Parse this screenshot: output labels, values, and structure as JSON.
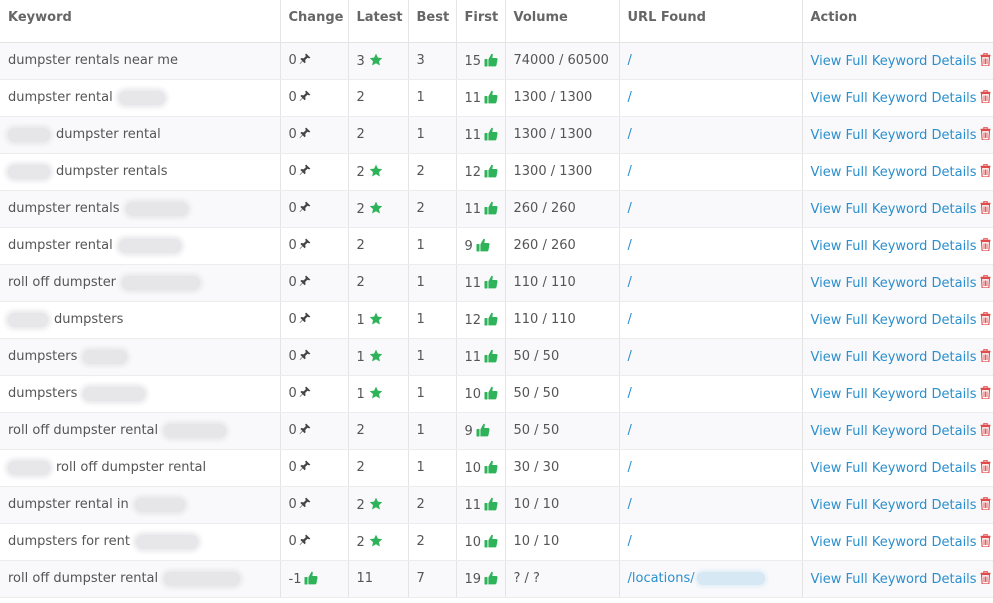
{
  "headers": {
    "keyword": "Keyword",
    "change": "Change",
    "latest": "Latest",
    "best": "Best",
    "first": "First",
    "volume": "Volume",
    "url": "URL Found",
    "action": "Action"
  },
  "action_label": "View Full Keyword Details",
  "rows": [
    {
      "kw_pre": "",
      "kw_text": "dumpster rentals near me",
      "kw_post": "",
      "change": "0",
      "change_icon": "pin-icon",
      "latest": "3",
      "latest_star": true,
      "best": "3",
      "first": "15",
      "volume": "74000 / 60500",
      "url": "/",
      "url_blurred": false
    },
    {
      "kw_pre": "",
      "kw_text": "dumpster rental",
      "kw_post": "blur",
      "change": "0",
      "change_icon": "pin-icon",
      "latest": "2",
      "latest_star": false,
      "best": "1",
      "first": "11",
      "volume": "1300 / 1300",
      "url": "/",
      "url_blurred": false
    },
    {
      "kw_pre": "blur",
      "kw_text": "dumpster rental",
      "kw_post": "",
      "change": "0",
      "change_icon": "pin-icon",
      "latest": "2",
      "latest_star": false,
      "best": "1",
      "first": "11",
      "volume": "1300 / 1300",
      "url": "/",
      "url_blurred": false
    },
    {
      "kw_pre": "blur",
      "kw_text": "dumpster rentals",
      "kw_post": "",
      "change": "0",
      "change_icon": "pin-icon",
      "latest": "2",
      "latest_star": true,
      "best": "2",
      "first": "12",
      "volume": "1300 / 1300",
      "url": "/",
      "url_blurred": false
    },
    {
      "kw_pre": "",
      "kw_text": "dumpster rentals",
      "kw_post": "blur",
      "change": "0",
      "change_icon": "pin-icon",
      "latest": "2",
      "latest_star": true,
      "best": "2",
      "first": "11",
      "volume": "260 / 260",
      "url": "/",
      "url_blurred": false
    },
    {
      "kw_pre": "",
      "kw_text": "dumpster rental",
      "kw_post": "blur",
      "change": "0",
      "change_icon": "pin-icon",
      "latest": "2",
      "latest_star": false,
      "best": "1",
      "first": "9",
      "volume": "260 / 260",
      "url": "/",
      "url_blurred": false
    },
    {
      "kw_pre": "",
      "kw_text": "roll off dumpster",
      "kw_post": "blur",
      "change": "0",
      "change_icon": "pin-icon",
      "latest": "2",
      "latest_star": false,
      "best": "1",
      "first": "11",
      "volume": "110 / 110",
      "url": "/",
      "url_blurred": false
    },
    {
      "kw_pre": "blur",
      "kw_text": "dumpsters",
      "kw_post": "",
      "change": "0",
      "change_icon": "pin-icon",
      "latest": "1",
      "latest_star": true,
      "best": "1",
      "first": "12",
      "volume": "110 / 110",
      "url": "/",
      "url_blurred": false
    },
    {
      "kw_pre": "",
      "kw_text": "dumpsters",
      "kw_post": "blur",
      "change": "0",
      "change_icon": "pin-icon",
      "latest": "1",
      "latest_star": true,
      "best": "1",
      "first": "11",
      "volume": "50 / 50",
      "url": "/",
      "url_blurred": false
    },
    {
      "kw_pre": "",
      "kw_text": "dumpsters",
      "kw_post": "blur",
      "change": "0",
      "change_icon": "pin-icon",
      "latest": "1",
      "latest_star": true,
      "best": "1",
      "first": "10",
      "volume": "50 / 50",
      "url": "/",
      "url_blurred": false
    },
    {
      "kw_pre": "",
      "kw_text": "roll off dumpster rental",
      "kw_post": "blur",
      "change": "0",
      "change_icon": "pin-icon",
      "latest": "2",
      "latest_star": false,
      "best": "1",
      "first": "9",
      "volume": "50 / 50",
      "url": "/",
      "url_blurred": false
    },
    {
      "kw_pre": "blur",
      "kw_text": "roll off dumpster rental",
      "kw_post": "",
      "change": "0",
      "change_icon": "pin-icon",
      "latest": "2",
      "latest_star": false,
      "best": "1",
      "first": "10",
      "volume": "30 / 30",
      "url": "/",
      "url_blurred": false
    },
    {
      "kw_pre": "",
      "kw_text": "dumpster rental in",
      "kw_post": "blur",
      "change": "0",
      "change_icon": "pin-icon",
      "latest": "2",
      "latest_star": true,
      "best": "2",
      "first": "11",
      "volume": "10 / 10",
      "url": "/",
      "url_blurred": false
    },
    {
      "kw_pre": "",
      "kw_text": "dumpsters for rent",
      "kw_post": "blur",
      "change": "0",
      "change_icon": "pin-icon",
      "latest": "2",
      "latest_star": true,
      "best": "2",
      "first": "10",
      "volume": "10 / 10",
      "url": "/",
      "url_blurred": false
    },
    {
      "kw_pre": "",
      "kw_text": "roll off dumpster rental",
      "kw_post": "blur",
      "change": "-1",
      "change_icon": "thumbs-up-icon",
      "latest": "11",
      "latest_star": false,
      "best": "7",
      "first": "19",
      "volume": "? / ?",
      "url": "/locations/",
      "url_blurred": true
    }
  ],
  "colors": {
    "link": "#2a8fcd",
    "green": "#2fb35a",
    "trash": "#e04b4b",
    "pin": "#444444"
  }
}
